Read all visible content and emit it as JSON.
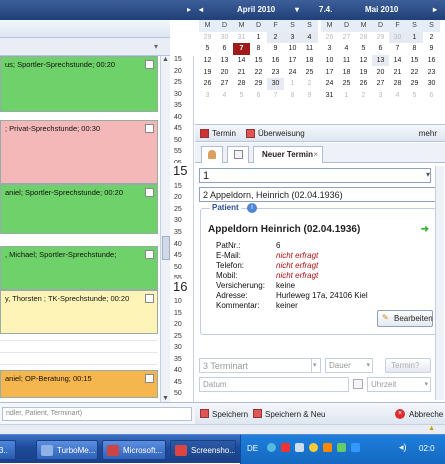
{
  "left_panel": {
    "appointments": [
      {
        "text": "us; Sportler-Sprechstunde; 00:20",
        "color": "#6fd16a"
      },
      {
        "text": "; Privat-Sprechstunde; 00:30",
        "color": "#f4b8b8"
      },
      {
        "text": "aniel; Sportler-Sprechstunde; 00:20",
        "color": "#6fd16a"
      },
      {
        "text": ", Michael; Sportler-Sprechstunde;",
        "color": "#6fd16a"
      },
      {
        "text": "y, Thorsten ; TK-Sprechstunde; 00:20",
        "color": "#fff4b8"
      },
      {
        "text": "aniel; OP-Beratung; 00:15",
        "color": "#f6b64e"
      }
    ],
    "search_placeholder": "ndler, Patient, Terminart)"
  },
  "times": {
    "big_hours": [
      "15",
      "16"
    ],
    "minutes": [
      "15",
      "20",
      "25",
      "30",
      "35",
      "40",
      "45",
      "50",
      "55",
      "05",
      "10",
      "15",
      "20",
      "25",
      "30",
      "35",
      "40",
      "45",
      "50",
      "55",
      "05",
      "10",
      "15",
      "20",
      "25",
      "30",
      "35",
      "40",
      "45",
      "50"
    ]
  },
  "calendar": {
    "month1": "April 2010",
    "today_label": "7.4.",
    "month2": "Mai 2010",
    "dow": [
      "M",
      "D",
      "M",
      "D",
      "F",
      "S",
      "S"
    ],
    "april": [
      [
        "29",
        "30",
        "31",
        "1",
        "2",
        "3",
        "4"
      ],
      [
        "5",
        "6",
        "7",
        "8",
        "9",
        "10",
        "11"
      ],
      [
        "12",
        "13",
        "14",
        "15",
        "16",
        "17",
        "18"
      ],
      [
        "19",
        "20",
        "21",
        "22",
        "23",
        "24",
        "25"
      ],
      [
        "26",
        "27",
        "28",
        "29",
        "30",
        "1",
        "2"
      ],
      [
        "3",
        "4",
        "5",
        "6",
        "7",
        "8",
        "9"
      ]
    ],
    "mai": [
      [
        "26",
        "27",
        "28",
        "29",
        "30",
        "1",
        "2"
      ],
      [
        "3",
        "4",
        "5",
        "6",
        "7",
        "8",
        "9"
      ],
      [
        "10",
        "11",
        "12",
        "13",
        "14",
        "15",
        "16"
      ],
      [
        "17",
        "18",
        "19",
        "20",
        "21",
        "22",
        "23"
      ],
      [
        "24",
        "25",
        "26",
        "27",
        "28",
        "29",
        "30"
      ],
      [
        "31",
        "1",
        "2",
        "3",
        "4",
        "5",
        "6"
      ]
    ]
  },
  "toolbar": {
    "termin": "Termin",
    "ueberweisung": "Überweisung",
    "mehr": "mehr"
  },
  "tabs": {
    "neuer_termin": "Neuer Termin"
  },
  "form": {
    "count_value": "1",
    "patient_value": "2 Appeldorn, Heinrich (02.04.1936)",
    "patient_group_label": "Patient",
    "patient_name": "Appeldorn Heinrich (02.04.1936)",
    "fields": [
      {
        "label": "PatNr.:",
        "value": "6",
        "warn": false
      },
      {
        "label": "E-Mail:",
        "value": "nicht erfragt",
        "warn": true
      },
      {
        "label": "Telefon:",
        "value": "nicht erfragt",
        "warn": true
      },
      {
        "label": "Mobil:",
        "value": "nicht erfragt",
        "warn": true
      },
      {
        "label": "Versicherung:",
        "value": "keine",
        "warn": false
      },
      {
        "label": "Adresse:",
        "value": "Hurleweg 17a, 24106 Kiel",
        "warn": false
      },
      {
        "label": "Kommentar:",
        "value": "keiner",
        "warn": false
      }
    ],
    "bearbeiten": "Bearbeiten",
    "terminart_placeholder": "3 Terminart",
    "dauer_placeholder": "Dauer",
    "termin_placeholder": "Termin?",
    "datum_placeholder": "Datum",
    "uhrzeit_placeholder": "Uhrzeit"
  },
  "bottom": {
    "speichern": "Speichern",
    "speichern_neu": "Speichern & Neu",
    "abbrechen": "Abbreche"
  },
  "taskbar": {
    "items": [
      "TurboMe...",
      "Microsoft...",
      "Screensho..."
    ],
    "lang": "DE",
    "clock": "02:0"
  }
}
